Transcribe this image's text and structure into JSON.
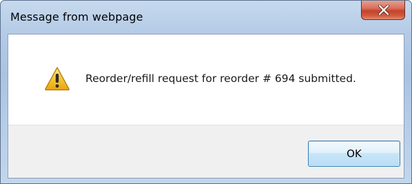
{
  "window": {
    "title": "Message from webpage",
    "close_icon": "close-icon"
  },
  "dialog": {
    "icon": "warning-icon",
    "message": "Reorder/refill request for reorder # 694 submitted.",
    "ok_label": "OK"
  },
  "colors": {
    "titlebar": "#b4cbe6",
    "close_button": "#c7422a",
    "button_area": "#f0f0f0",
    "ok_border": "#3c7fb1",
    "warning_fill": "#f6c431"
  }
}
